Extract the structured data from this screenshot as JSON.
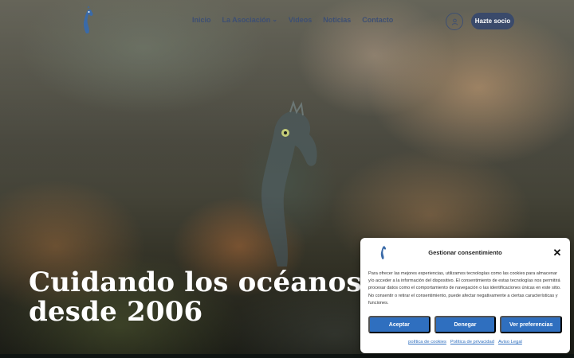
{
  "header": {
    "logo_icon": "seahorse-logo-icon",
    "nav": [
      {
        "label": "Inicio"
      },
      {
        "label": "La Asociación",
        "icon": "chevron-down-icon"
      },
      {
        "label": "Videos"
      },
      {
        "label": "Noticias"
      },
      {
        "label": "Contacto"
      }
    ],
    "user_icon": "user-icon",
    "cta_label": "Hazte socio"
  },
  "hero": {
    "title_line1": "Cuidando los océanos",
    "title_line2": "desde 2006"
  },
  "consent": {
    "title": "Gestionar consentimiento",
    "close_icon": "close-icon",
    "text": "Para ofrecer las mejores experiencias, utilizamos tecnologías como las cookies para almacenar y/o acceder a la información del dispositivo. El consentimiento de estas tecnologías nos permitirá procesar datos como el comportamiento de navegación o las identificaciones únicas en este sitio. No consentir o retirar el consentimiento, puede afectar negativamente a ciertas características y funciones.",
    "buttons": {
      "accept": "Aceptar",
      "deny": "Denegar",
      "preferences": "Ver preferencias"
    },
    "links": {
      "cookies": "política de cookies",
      "privacy": "Política de privacidad",
      "legal": "Aviso Legal"
    }
  },
  "colors": {
    "brand": "#3a4a6b",
    "nav_text": "#3d4f73",
    "consent_accent": "#2f6fbf"
  }
}
